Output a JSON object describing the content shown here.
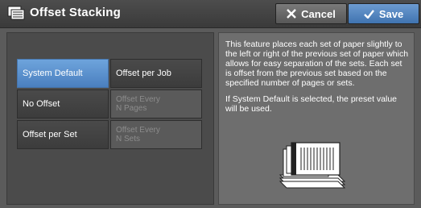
{
  "header": {
    "title": "Offset Stacking",
    "cancel_label": "Cancel",
    "save_label": "Save"
  },
  "options": [
    {
      "label": "System Default",
      "state": "selected"
    },
    {
      "label": "Offset per Job",
      "state": "normal"
    },
    {
      "label": "No Offset",
      "state": "normal"
    },
    {
      "label": "Offset Every\nN Pages",
      "state": "disabled"
    },
    {
      "label": "Offset per Set",
      "state": "normal"
    },
    {
      "label": "Offset Every\nN Sets",
      "state": "disabled"
    }
  ],
  "description": {
    "paragraph1": "This feature places each set of paper slightly to the left or right of the previous set of paper which allows for easy separation of the sets. Each set is offset from the previous set based on the specified number of pages or sets.",
    "paragraph2": "If System Default is selected, the preset value will be used."
  },
  "colors": {
    "selected": "#5a90cf",
    "save": "#4a7fbf"
  },
  "icons": {
    "title": "offset-stacking-icon",
    "cancel": "close-x-icon",
    "save": "checkmark-icon",
    "illustration": "offset-paper-stack-illustration"
  }
}
